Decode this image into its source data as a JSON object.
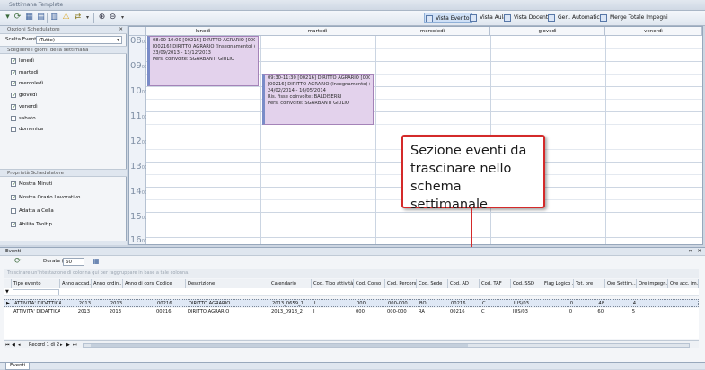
{
  "window": {
    "title": "Settimana Template"
  },
  "toolbar": {
    "views": [
      {
        "label": "Vista Evento",
        "active": true
      },
      {
        "label": "Vista Aula",
        "active": false
      },
      {
        "label": "Vista Docente",
        "active": false
      },
      {
        "label": "Gen. Automatica",
        "active": false
      },
      {
        "label": "Merge Totale Impegni",
        "active": false
      }
    ]
  },
  "options_panel": {
    "title": "Opzioni Schedulatore",
    "scelta_label": "Scelta Eventi:",
    "scelta_value": "(Tutte)",
    "days_header": "Scegliere i giorni della settimana",
    "days": [
      {
        "label": "lunedì",
        "checked": true
      },
      {
        "label": "martedì",
        "checked": true
      },
      {
        "label": "mercoledì",
        "checked": true
      },
      {
        "label": "giovedì",
        "checked": true
      },
      {
        "label": "venerdì",
        "checked": true
      },
      {
        "label": "sabato",
        "checked": false
      },
      {
        "label": "domenica",
        "checked": false
      }
    ],
    "props_header": "Proprietà Schedulatore",
    "props": [
      {
        "label": "Mostra Minuti",
        "checked": true
      },
      {
        "label": "Mostra Orario Lavorativo",
        "checked": true
      },
      {
        "label": "Adatta a Cella",
        "checked": false
      },
      {
        "label": "Abilita Tooltip",
        "checked": true
      }
    ]
  },
  "scheduler": {
    "days": [
      "lunedì",
      "martedì",
      "mercoledì",
      "giovedì",
      "venerdì"
    ],
    "hours": [
      "08",
      "09",
      "10",
      "11",
      "12",
      "13",
      "14",
      "15",
      "16"
    ],
    "minutes_suffix": "00",
    "appointments": [
      {
        "line1": "08:00-10:00 [00216] DIRITTO AGRARIO [000]",
        "line2": "[00216] DIRITTO AGRARIO (Insegnamento) (-)",
        "line3": "23/09/2013 - 13/12/2013",
        "line4": "",
        "line5": "Pers. coinvolte: SGARBANTI GIULIO"
      },
      {
        "line1": "09:30-11:30 [00216] DIRITTO AGRARIO [000]",
        "line2": "[00216] DIRITTO AGRARIO (Insegnamento) (-)",
        "line3": "24/02/2014 - 16/05/2014",
        "line4": "Ris. fisse coinvolte: BALDISERRI",
        "line5": "Pers. coinvolte: SGARBANTI GIULIO"
      }
    ]
  },
  "callout": {
    "text": "Sezione eventi da trascinare nello schema settimanale"
  },
  "events_panel": {
    "title": "Eventi",
    "durata_label": "Durata (min.)",
    "durata_value": "60",
    "group_hint": "Trascinare un'intestazione di colonna qui per raggruppare in base a tale colonna.",
    "columns": [
      "Tipo evento",
      "Anno accad...",
      "Anno ordin...",
      "Anno di corso",
      "Codice",
      "Descrizione",
      "Calendario",
      "Cod. Tipo attività",
      "Cod. Corso",
      "Cod. Percorso",
      "Cod. Sede",
      "Cod. AD",
      "Cod. TAF",
      "Cod. SSD",
      "Flag Logico ...",
      "Tot. ore",
      "Ore Settim...",
      "Ore impegn...",
      "Ore acc. im..."
    ],
    "rows": [
      [
        "ATTIVITA' DIDATTICA",
        "2013",
        "2013",
        "",
        "00216",
        "DIRITTO AGRARIO",
        "2013_0659_1",
        "I",
        "000",
        "000-000",
        "BO",
        "00216",
        "C",
        "IUS/03",
        "0",
        "48",
        "4",
        "",
        ""
      ],
      [
        "ATTIVITA' DIDATTICA",
        "2013",
        "2013",
        "",
        "00216",
        "DIRITTO AGRARIO",
        "2013_0918_2",
        "I",
        "000",
        "000-000",
        "RA",
        "00216",
        "C",
        "IUS/03",
        "0",
        "60",
        "5",
        "",
        ""
      ]
    ],
    "pager": "Record 1 di 2"
  },
  "bottom_tab": "Eventi"
}
